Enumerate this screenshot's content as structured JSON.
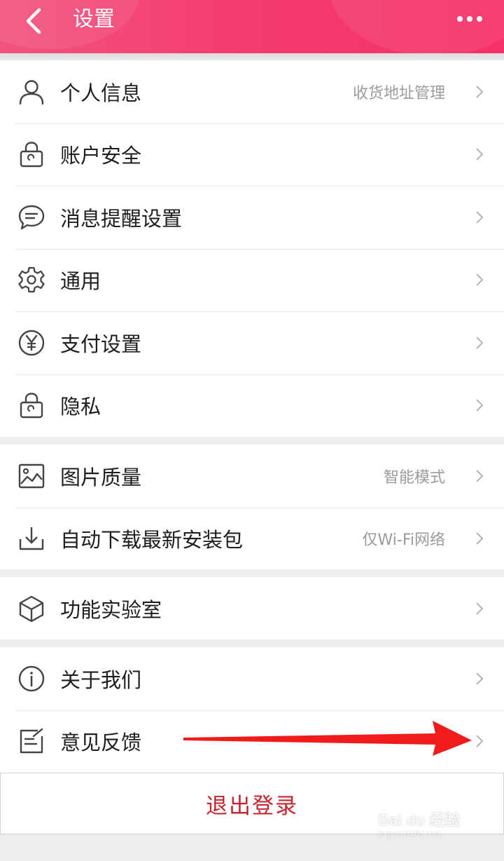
{
  "header": {
    "title": "设置",
    "back_icon": "chevron-left-icon",
    "more_icon": "more-dots-icon",
    "gradient": [
      "#f2547e",
      "#f5306a"
    ]
  },
  "groups": [
    {
      "items": [
        {
          "icon": "user-icon",
          "label": "个人信息",
          "value": "收货地址管理"
        },
        {
          "icon": "lock-icon",
          "label": "账户安全",
          "value": ""
        },
        {
          "icon": "message-icon",
          "label": "消息提醒设置",
          "value": ""
        },
        {
          "icon": "gear-icon",
          "label": "通用",
          "value": ""
        },
        {
          "icon": "yen-icon",
          "label": "支付设置",
          "value": ""
        },
        {
          "icon": "lock-icon",
          "label": "隐私",
          "value": ""
        }
      ]
    },
    {
      "items": [
        {
          "icon": "image-icon",
          "label": "图片质量",
          "value": "智能模式"
        },
        {
          "icon": "download-icon",
          "label": "自动下载最新安装包",
          "value": "仅Wi-Fi网络"
        }
      ]
    },
    {
      "items": [
        {
          "icon": "cube-icon",
          "label": "功能实验室",
          "value": ""
        }
      ]
    },
    {
      "items": [
        {
          "icon": "info-icon",
          "label": "关于我们",
          "value": ""
        },
        {
          "icon": "edit-icon",
          "label": "意见反馈",
          "value": ""
        }
      ]
    }
  ],
  "logout": {
    "label": "退出登录",
    "color": "#c8232c"
  },
  "annotation": {
    "arrow_color": "#f01c1c"
  },
  "watermark": {
    "main": "Bai du 经验",
    "sub": "jingyan.baidu.com"
  }
}
